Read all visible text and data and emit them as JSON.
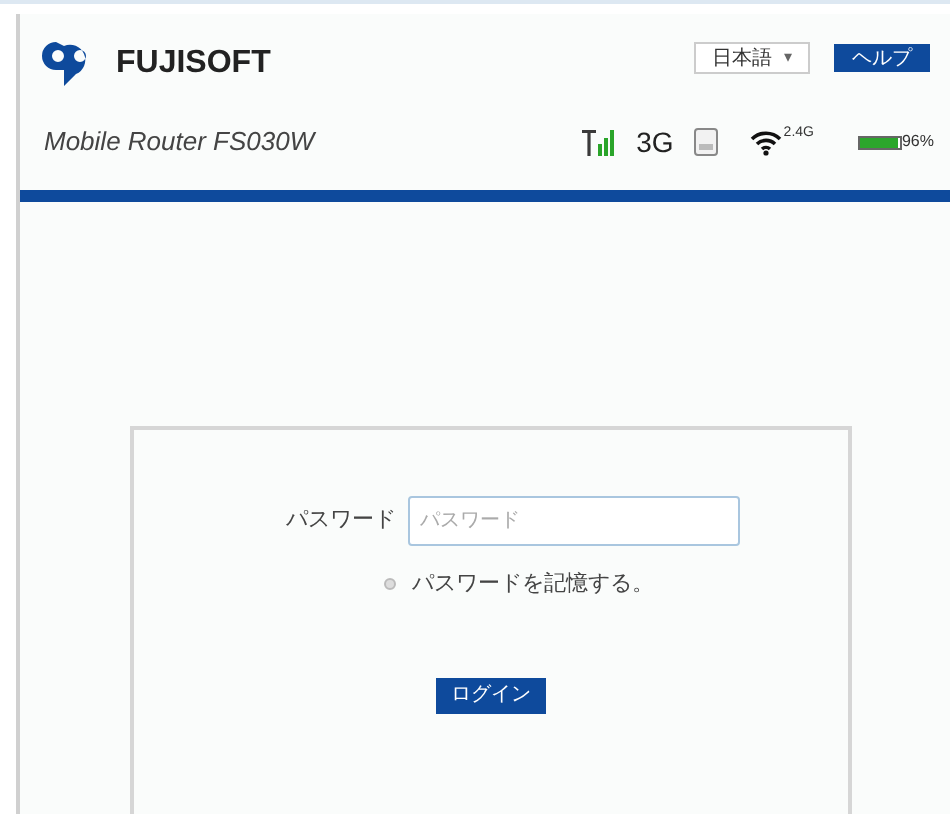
{
  "header": {
    "brand": "FUJISOFT",
    "model": "Mobile Router FS030W",
    "language": "日本語",
    "language_caret": "▾",
    "help_button": "ヘルプ",
    "network_type": "3G",
    "wifi_band": "2.4G",
    "battery": {
      "level": 0.96,
      "reading": "96%"
    }
  },
  "login": {
    "password_label": "パスワード",
    "password_placeholder": "パスワード",
    "remember": {
      "label": "パスワードを記憶する。",
      "checked": false
    },
    "login_button": "ログイン"
  }
}
